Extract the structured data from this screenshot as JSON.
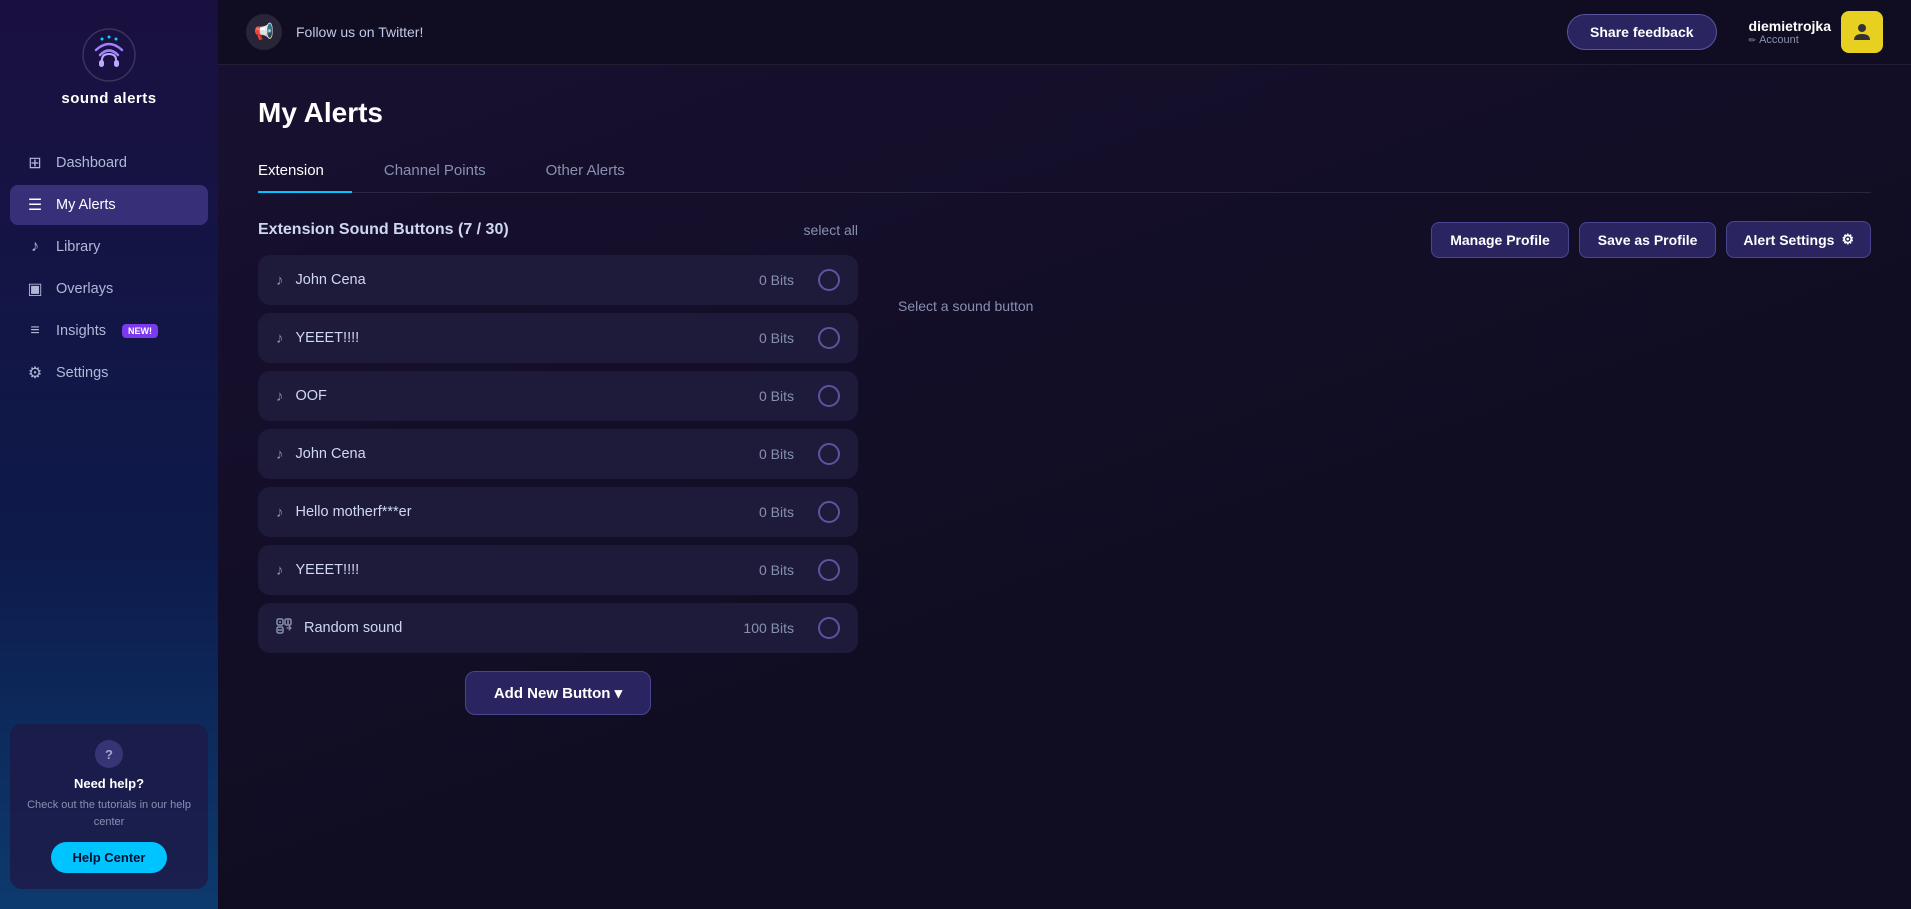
{
  "app": {
    "name": "sound alerts"
  },
  "sidebar": {
    "logo_alt": "sound alerts logo",
    "nav_items": [
      {
        "id": "dashboard",
        "label": "Dashboard",
        "icon": "grid",
        "active": false
      },
      {
        "id": "my-alerts",
        "label": "My Alerts",
        "icon": "list",
        "active": true
      },
      {
        "id": "library",
        "label": "Library",
        "icon": "music-note",
        "active": false
      },
      {
        "id": "overlays",
        "label": "Overlays",
        "icon": "image",
        "active": false
      },
      {
        "id": "insights",
        "label": "Insights",
        "icon": "list-alt",
        "active": false,
        "badge": "New!"
      },
      {
        "id": "settings",
        "label": "Settings",
        "icon": "gear",
        "active": false
      }
    ],
    "help": {
      "title": "Need help?",
      "desc": "Check out the tutorials in our help center",
      "btn_label": "Help Center"
    }
  },
  "topbar": {
    "twitter_text": "Follow us on Twitter!",
    "share_btn": "Share feedback",
    "username": "diemietrojka",
    "account_label": "Account"
  },
  "page": {
    "title": "My Alerts",
    "tabs": [
      {
        "id": "extension",
        "label": "Extension",
        "active": true
      },
      {
        "id": "channel-points",
        "label": "Channel Points",
        "active": false
      },
      {
        "id": "other-alerts",
        "label": "Other Alerts",
        "active": false
      }
    ]
  },
  "alerts": {
    "header_title": "Extension Sound Buttons (7 / 30)",
    "select_all_label": "select all",
    "manage_profile_btn": "Manage Profile",
    "save_as_profile_btn": "Save as Profile",
    "alert_settings_btn": "Alert Settings",
    "select_hint": "Select a sound button",
    "sound_buttons": [
      {
        "id": 1,
        "name": "John Cena",
        "bits": "0 Bits",
        "type": "note"
      },
      {
        "id": 2,
        "name": "YEEET!!!!",
        "bits": "0 Bits",
        "type": "note"
      },
      {
        "id": 3,
        "name": "OOF",
        "bits": "0 Bits",
        "type": "note"
      },
      {
        "id": 4,
        "name": "John Cena",
        "bits": "0 Bits",
        "type": "note"
      },
      {
        "id": 5,
        "name": "Hello motherf***er",
        "bits": "0 Bits",
        "type": "note"
      },
      {
        "id": 6,
        "name": "YEEET!!!!",
        "bits": "0 Bits",
        "type": "note"
      },
      {
        "id": 7,
        "name": "Random sound",
        "bits": "100 Bits",
        "type": "random"
      }
    ],
    "add_new_btn": "Add New Button ▾"
  }
}
